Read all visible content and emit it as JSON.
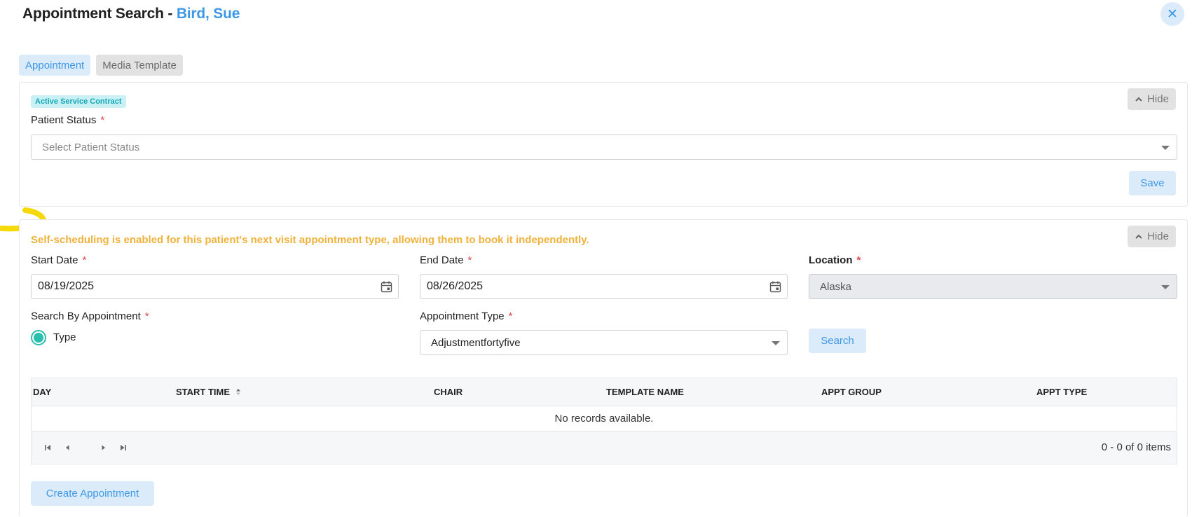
{
  "header": {
    "title": "Appointment Search -",
    "patient_name": "Bird, Sue",
    "close_glyph": "✕"
  },
  "tabs": [
    {
      "label": "Appointment",
      "active": true
    },
    {
      "label": "Media Template",
      "active": false
    }
  ],
  "contract_panel": {
    "badge": "Active Service Contract",
    "hide_label": "Hide",
    "patient_status_label": "Patient Status",
    "required_mark": "*",
    "patient_status_placeholder": "Select Patient Status",
    "save_label": "Save"
  },
  "search_panel": {
    "hide_label": "Hide",
    "notice": "Self-scheduling is enabled for this patient's next visit appointment type, allowing them to book it independently.",
    "start_date_label": "Start Date",
    "start_date_value": "08/19/2025",
    "end_date_label": "End Date",
    "end_date_value": "08/26/2025",
    "location_label": "Location",
    "location_value": "Alaska",
    "search_by_label": "Search By Appointment",
    "radio_label": "Type",
    "appt_type_label": "Appointment Type",
    "appt_type_value": "Adjustmentfortyfive",
    "search_label": "Search",
    "required_mark": "*"
  },
  "grid": {
    "columns": [
      "DAY",
      "START TIME",
      "CHAIR",
      "TEMPLATE NAME",
      "APPT GROUP",
      "APPT TYPE"
    ],
    "empty_text": "No records available.",
    "pager_info": "0 - 0 of 0 items"
  },
  "footer": {
    "create_label": "Create Appointment"
  },
  "colors": {
    "accent": "#3d98e8",
    "notice": "#f0b23c",
    "radio": "#2bbfae",
    "badge_text": "#13a7b8",
    "badge_bg": "#c9f0f4",
    "highlight_mark": "#f5d90a"
  }
}
